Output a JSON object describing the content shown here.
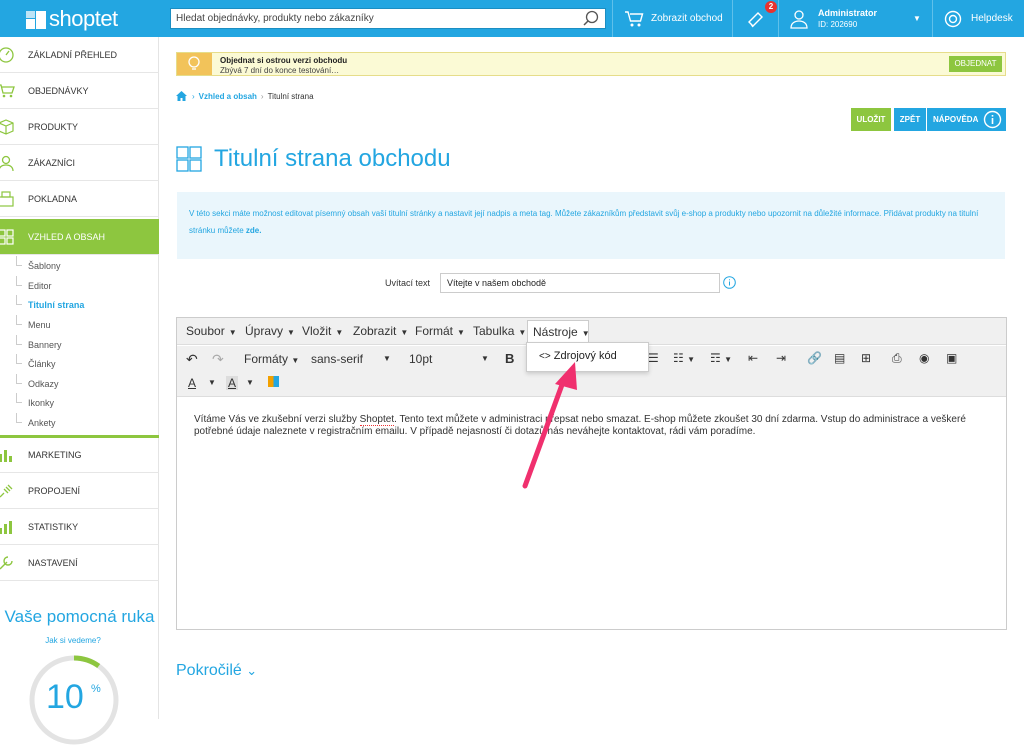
{
  "topbar": {
    "logo": "shoptet",
    "search_placeholder": "Hledat objednávky, produkty nebo zákazníky",
    "view_shop": "Zobrazit obchod",
    "notifications": "2",
    "user_name": "Administrator",
    "user_id": "ID: 202690",
    "helpdesk": "Helpdesk"
  },
  "sidebar": {
    "items": [
      {
        "label": "ZÁKLADNÍ PŘEHLED",
        "icon": "dashboard-icon"
      },
      {
        "label": "OBJEDNÁVKY",
        "icon": "cart-icon"
      },
      {
        "label": "PRODUKTY",
        "icon": "box-icon"
      },
      {
        "label": "ZÁKAZNÍCI",
        "icon": "user-icon"
      },
      {
        "label": "POKLADNA",
        "icon": "register-icon"
      },
      {
        "label": "VZHLED A OBSAH",
        "icon": "layout-icon"
      }
    ],
    "subitems": [
      "Šablony",
      "Editor",
      "Titulní strana",
      "Menu",
      "Bannery",
      "Články",
      "Odkazy",
      "Ikonky",
      "Ankety"
    ],
    "items2": [
      {
        "label": "MARKETING",
        "icon": "chart-icon"
      },
      {
        "label": "PROPOJENÍ",
        "icon": "plug-icon"
      },
      {
        "label": "STATISTIKY",
        "icon": "stats-icon"
      },
      {
        "label": "NASTAVENÍ",
        "icon": "wrench-icon"
      }
    ],
    "helper_title": "Vaše pomocná ruka",
    "helper_link": "Jak si vedeme?",
    "gauge_value": "10",
    "gauge_unit": "%",
    "gauge_fraction": 0.1
  },
  "trial": {
    "title": "Objednat si ostrou verzi obchodu",
    "subtitle": "Zbývá 7 dní do konce testování…",
    "button": "OBJEDNAT"
  },
  "breadcrumb": {
    "section": "Vzhled a obsah",
    "current": "Titulní strana"
  },
  "actions": {
    "save": "ULOŽIT",
    "back": "ZPĚT",
    "help": "NÁPOVĚDA"
  },
  "page": {
    "title": "Titulní strana obchodu",
    "info": "V této sekci máte možnost editovat písemný obsah vaší titulní stránky a nastavit její nadpis a meta tag. Můžete zákazníkům představit svůj e-shop a produkty nebo upozornit na důležité informace. Přidávat produkty na titulní stránku můžete ",
    "info_link": "zde.",
    "welcome_label": "Uvítací text",
    "welcome_value": "Vítejte v našem obchodě",
    "advanced": "Pokročilé"
  },
  "editor": {
    "menus": [
      "Soubor",
      "Úpravy",
      "Vložit",
      "Zobrazit",
      "Formát",
      "Tabulka",
      "Nástroje"
    ],
    "formats": "Formáty",
    "font": "sans-serif",
    "size": "10pt",
    "dropdown_item": "Zdrojový kód",
    "content_a": "Vítáme Vás ve zkušební verzi služby ",
    "content_brand": "Shoptet",
    "content_b": ". Tento text můžete v administraci přepsat nebo smazat. E-shop můžete zkoušet 30 dní zdarma. Vstup do administrace a veškeré potřebné údaje naleznete v registračním emailu. V případě nejasností či dotazů nás neváhejte kontaktovat, rádi vám poradíme."
  },
  "colors": {
    "accent": "#23a6e1",
    "green": "#8dc63f",
    "arrow": "#f0306e"
  }
}
